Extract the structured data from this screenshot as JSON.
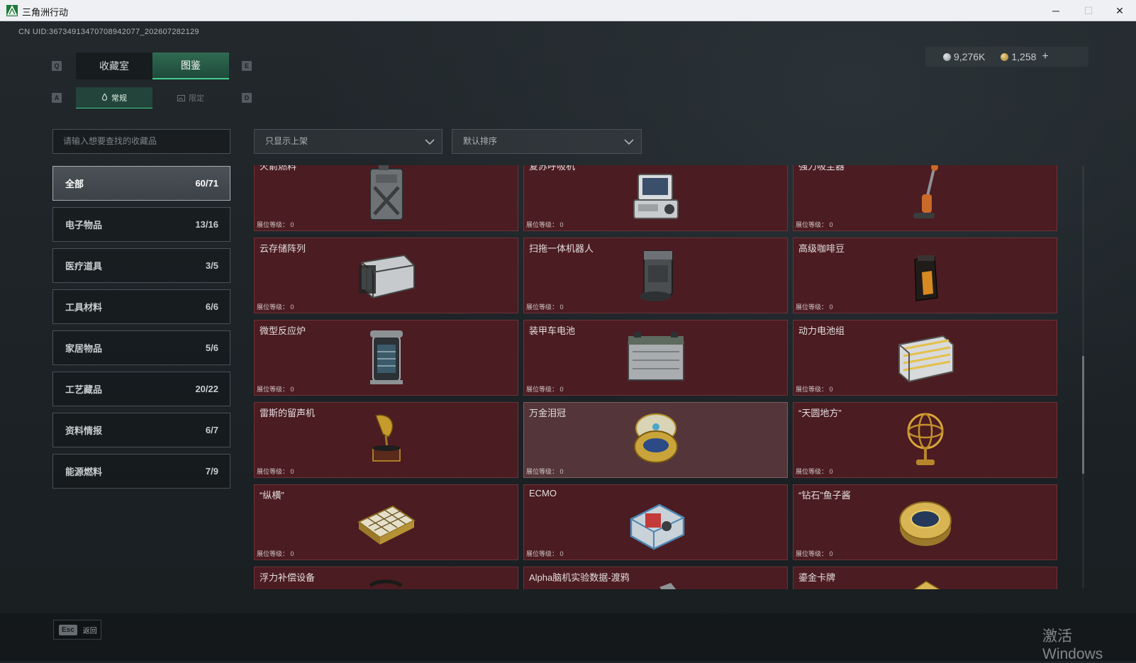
{
  "window": {
    "title": "三角洲行动",
    "minimize": "─",
    "maximize": "☐",
    "close": "✕"
  },
  "uid": "CN UID:3673491347070894207​7_202607282129",
  "currency": [
    {
      "icon": "silver-coin-icon",
      "value": "9,276K",
      "color": "#b9bdc0"
    },
    {
      "icon": "gold-coin-icon",
      "value": "1,258",
      "color": "#c9a65a"
    }
  ],
  "currency_add": "+",
  "keys": {
    "q": "Q",
    "e": "E",
    "a": "A",
    "d": "D"
  },
  "tabs": [
    {
      "label": "收藏室",
      "active": false
    },
    {
      "label": "图鉴",
      "active": true
    }
  ],
  "subtabs": [
    {
      "label": "常规",
      "active": true
    },
    {
      "label": "限定",
      "active": false
    }
  ],
  "search": {
    "placeholder": "请输入想要查找的收藏品"
  },
  "filters": {
    "shelf": "只显示上架",
    "sort": "默认排序"
  },
  "categories": [
    {
      "label": "全部",
      "count": "60/71",
      "active": true
    },
    {
      "label": "电子物品",
      "count": "13/16"
    },
    {
      "label": "医疗道具",
      "count": "3/5"
    },
    {
      "label": "工具材料",
      "count": "6/6"
    },
    {
      "label": "家居物品",
      "count": "5/6"
    },
    {
      "label": "工艺藏品",
      "count": "20/22"
    },
    {
      "label": "资料情报",
      "count": "6/7"
    },
    {
      "label": "能源燃料",
      "count": "7/9"
    }
  ],
  "level_label": "展位等级： 0",
  "cards": [
    {
      "name": "火箭燃料",
      "icon": "fuel-can-icon"
    },
    {
      "name": "复苏呼吸机",
      "icon": "ventilator-icon"
    },
    {
      "name": "强力吸尘器",
      "icon": "vacuum-icon"
    },
    {
      "name": "云存储阵列",
      "icon": "storage-array-icon"
    },
    {
      "name": "扫拖一体机器人",
      "icon": "robot-vacuum-icon"
    },
    {
      "name": "高级咖啡豆",
      "icon": "coffee-bag-icon"
    },
    {
      "name": "微型反应炉",
      "icon": "reactor-icon"
    },
    {
      "name": "装甲车电池",
      "icon": "battery-icon"
    },
    {
      "name": "动力电池组",
      "icon": "battery-pack-icon"
    },
    {
      "name": "雷斯的留声机",
      "icon": "gramophone-icon"
    },
    {
      "name": "万金泪冠",
      "icon": "jeweled-egg-icon",
      "highlight": true
    },
    {
      "name": "“天圆地方”",
      "icon": "armillary-sphere-icon"
    },
    {
      "name": "“纵横”",
      "icon": "chessboard-icon"
    },
    {
      "name": "ECMO",
      "icon": "ecmo-machine-icon"
    },
    {
      "name": "“钻石”鱼子酱",
      "icon": "caviar-tin-icon"
    },
    {
      "name": "浮力补偿设备",
      "icon": "bcd-icon"
    },
    {
      "name": "Alpha脑机实验数据-渡鸦",
      "icon": "data-drive-icon"
    },
    {
      "name": "鎏金卡牌",
      "icon": "gold-card-icon"
    }
  ],
  "footer": {
    "esc_key": "Esc",
    "back": "返回"
  },
  "watermark": "激活 Windows"
}
